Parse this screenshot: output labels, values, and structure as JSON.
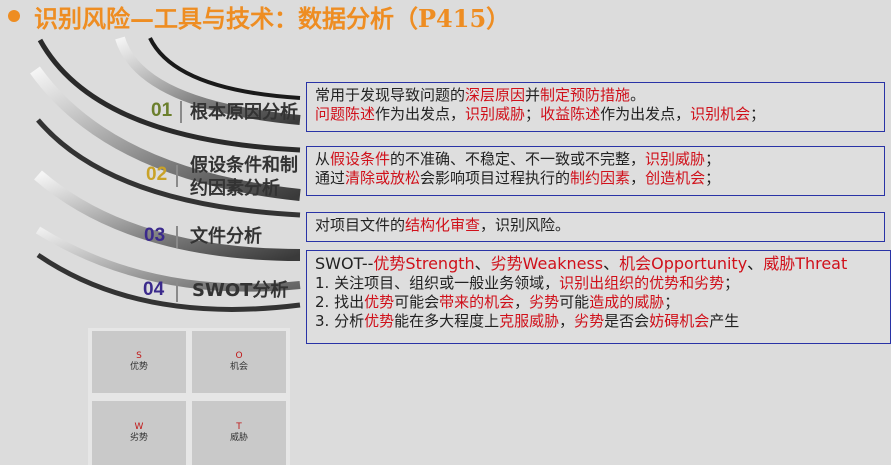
{
  "title": "识别风险—工具与技术：数据分析（P415）",
  "colors": {
    "title": "#ee8d22",
    "n1": "#6b7f2d",
    "n2": "#c9a227",
    "n3": "#3b2a8c",
    "n4": "#3b2a8c",
    "red": "#d0101a",
    "box_border": "#2933a6"
  },
  "items": [
    {
      "num": "01",
      "label_lines": [
        "根本原因分析"
      ],
      "desc": [
        [
          {
            "t": "常用于发现导致问题的"
          },
          {
            "t": "深层原因",
            "r": true
          },
          {
            "t": "并"
          },
          {
            "t": "制定预防措施",
            "r": true
          },
          {
            "t": "。"
          }
        ],
        [
          {
            "t": "问题陈述",
            "r": true
          },
          {
            "t": "作为出发点，"
          },
          {
            "t": "识别威胁",
            "r": true
          },
          {
            "t": "；"
          },
          {
            "t": "收益陈述",
            "r": true
          },
          {
            "t": "作为出发点，"
          },
          {
            "t": "识别机会",
            "r": true
          },
          {
            "t": "；"
          }
        ]
      ]
    },
    {
      "num": "02",
      "label_lines": [
        "假设条件和制",
        "约因素分析"
      ],
      "desc": [
        [
          {
            "t": "从"
          },
          {
            "t": "假设条件",
            "r": true
          },
          {
            "t": "的不准确、不稳定、不一致或不完整，"
          },
          {
            "t": "识别威胁",
            "r": true
          },
          {
            "t": "；"
          }
        ],
        [
          {
            "t": "通过"
          },
          {
            "t": "清除或放松",
            "r": true
          },
          {
            "t": "会影响项目过程执行的"
          },
          {
            "t": "制约因素",
            "r": true
          },
          {
            "t": "，"
          },
          {
            "t": "创造机会",
            "r": true
          },
          {
            "t": "；"
          }
        ]
      ]
    },
    {
      "num": "03",
      "label_lines": [
        "文件分析"
      ],
      "desc": [
        [
          {
            "t": "对项目文件的"
          },
          {
            "t": "结构化审查",
            "r": true
          },
          {
            "t": "，识别风险。"
          }
        ]
      ]
    },
    {
      "num": "04",
      "label_lines": [
        "SWOT分析"
      ],
      "desc": [
        [
          {
            "t": "SWOT--"
          },
          {
            "t": "优势Strength",
            "r": true
          },
          {
            "t": "、"
          },
          {
            "t": "劣势Weakness",
            "r": true
          },
          {
            "t": "、"
          },
          {
            "t": "机会Opportunity",
            "r": true
          },
          {
            "t": "、"
          },
          {
            "t": "威胁Threat",
            "r": true
          }
        ],
        [
          {
            "t": "1.    关注项目、组织或一般业务领域，"
          },
          {
            "t": "识别出组织的优势和劣势",
            "r": true
          },
          {
            "t": "；"
          }
        ],
        [
          {
            "t": "2.    找出"
          },
          {
            "t": "优势",
            "r": true
          },
          {
            "t": "可能会"
          },
          {
            "t": "带来的机会",
            "r": true
          },
          {
            "t": "，"
          },
          {
            "t": "劣势",
            "r": true
          },
          {
            "t": "可能"
          },
          {
            "t": "造成的威胁",
            "r": true
          },
          {
            "t": "；"
          }
        ],
        [
          {
            "t": "3.    分析"
          },
          {
            "t": "优势",
            "r": true
          },
          {
            "t": "能在多大程度上"
          },
          {
            "t": "克服威胁",
            "r": true
          },
          {
            "t": "，"
          },
          {
            "t": "劣势",
            "r": true
          },
          {
            "t": "是否会"
          },
          {
            "t": "妨碍机会",
            "r": true
          },
          {
            "t": "产生"
          }
        ]
      ]
    }
  ],
  "swot": [
    {
      "letter": "S",
      "word": "优势"
    },
    {
      "letter": "O",
      "word": "机会"
    },
    {
      "letter": "W",
      "word": "劣势"
    },
    {
      "letter": "T",
      "word": "威胁"
    }
  ]
}
